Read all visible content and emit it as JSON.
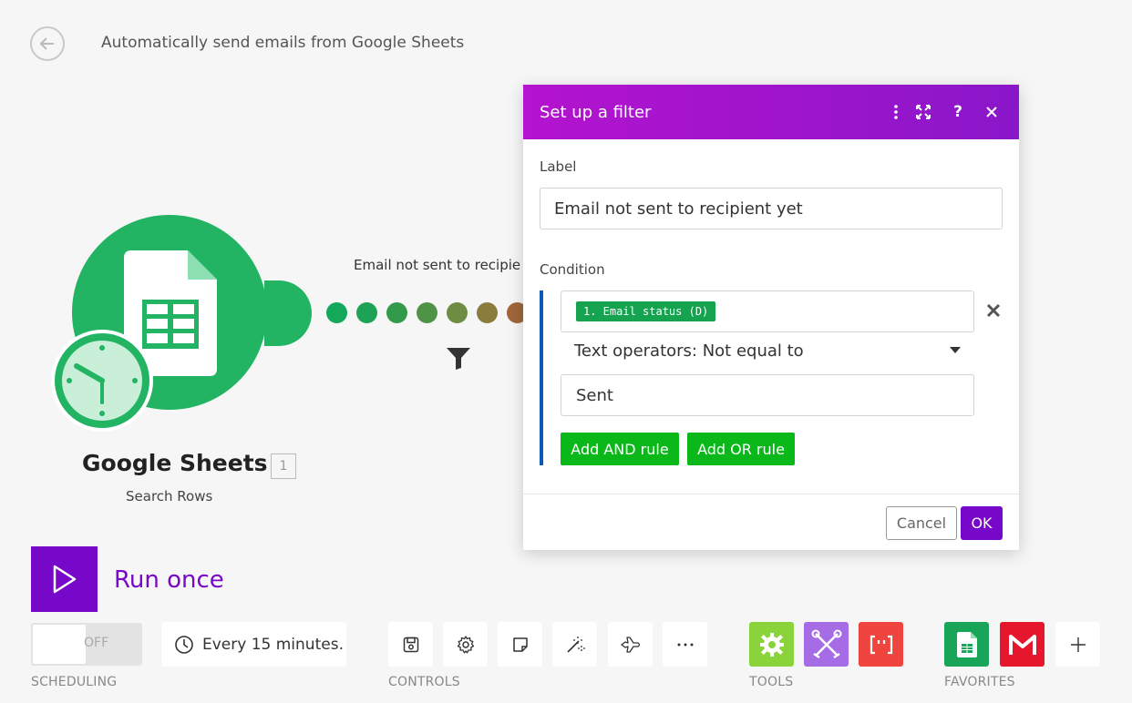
{
  "header": {
    "title": "Automatically send emails from Google Sheets",
    "back_icon": "arrow-left-icon"
  },
  "module": {
    "name": "Google Sheets",
    "id": "1",
    "subtitle": "Search Rows",
    "color": "#22b463"
  },
  "route": {
    "label": "Email not sent to recipie"
  },
  "run": {
    "label": "Run once",
    "color": "#7808c9"
  },
  "scheduling": {
    "toggle_state": "OFF",
    "interval": "Every 15 minutes.",
    "section": "SCHEDULING"
  },
  "controls": {
    "section": "CONTROLS",
    "items": [
      "save-icon",
      "gear-icon",
      "note-icon",
      "magic-wand-icon",
      "airplane-icon",
      "more-icon"
    ]
  },
  "tools": {
    "section": "TOOLS",
    "items": [
      "tools-gear-icon",
      "tools-flow-icon",
      "tools-text-icon"
    ]
  },
  "favorites": {
    "section": "FAVORITES",
    "items": [
      "google-sheets-icon",
      "gmail-icon",
      "plus-icon"
    ]
  },
  "dialog": {
    "title": "Set up a filter",
    "label_caption": "Label",
    "label_value": "Email not sent to recipient yet",
    "condition_caption": "Condition",
    "condition_token": "1. Email status (D)",
    "operator": "Text operators: Not equal to",
    "value": "Sent",
    "add_and": "Add AND rule",
    "add_or": "Add OR rule",
    "cancel": "Cancel",
    "ok": "OK",
    "header_color": "#b413cf"
  }
}
